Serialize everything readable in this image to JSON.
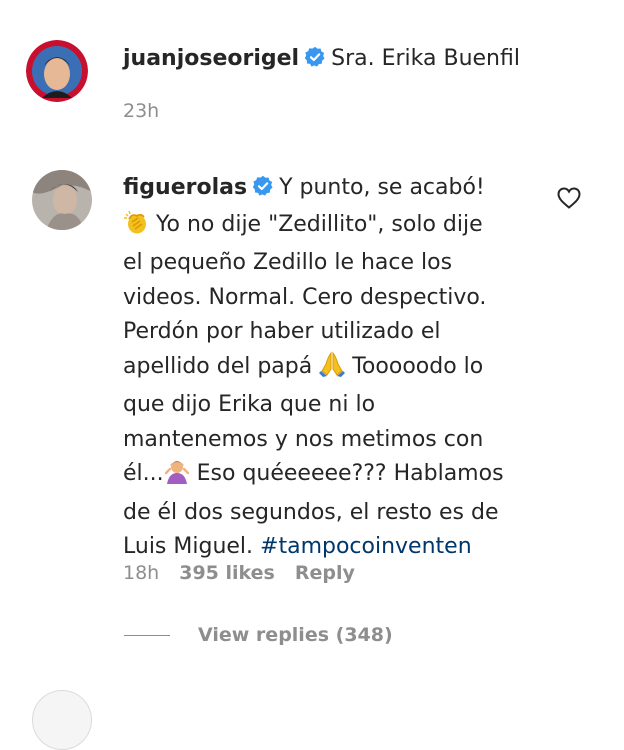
{
  "comments": [
    {
      "username": "juanjoseorigel",
      "verified": true,
      "text": "Sra. Erika Buenfil",
      "time": "23h"
    },
    {
      "username": "figuerolas",
      "verified": true,
      "lines": [
        "Y punto, se acabó!",
        "Yo no dije \"Zedillito\", solo dije",
        "el pequeño Zedillo le hace los",
        "videos. Normal. Cero despectivo.",
        "Perdón por haber utilizado el",
        "apellido del papá",
        "Tooooodo lo",
        "que dijo Erika que ni lo",
        "mantenemos y nos metimos con",
        "él...",
        "Eso quéeeeee??? Hablamos",
        "de él dos segundos, el resto es de",
        "Luis Miguel. ",
        "#tampocoinventen"
      ],
      "emojis": [
        "clapping-hands",
        "folded-hands",
        "person-shrugging"
      ],
      "time": "18h",
      "likes": "395 likes",
      "reply": "Reply",
      "view_replies": "View replies (348)"
    }
  ],
  "colors": {
    "text": "#262626",
    "secondary": "#8e8e8e",
    "verified": "#3897f0",
    "hashtag": "#00376b"
  }
}
